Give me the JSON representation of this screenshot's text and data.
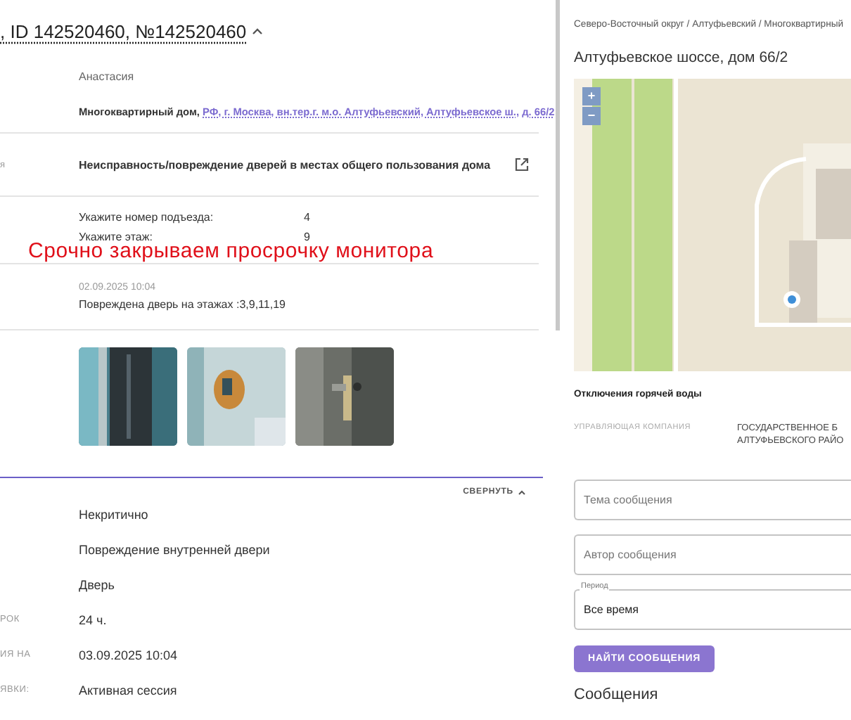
{
  "header": {
    "title": ", ID 142520460, №142520460",
    "expanded": true
  },
  "applicant": "Анастасия",
  "object": {
    "type": "Многоквартирный дом,",
    "address": "РФ, г. Москва, вн.тер.г. м.о. Алтуфьевский, Алтуфьевское ш., д. 66/2"
  },
  "problem": {
    "label": "я",
    "text": "Неисправность/повреждение дверей в местах общего пользования дома"
  },
  "questions": [
    {
      "question": "Укажите номер подъезда:",
      "answer": "4"
    },
    {
      "question": "Укажите этаж:",
      "answer": "9"
    }
  ],
  "overlay_note": "Срочно закрываем просрочку монитора",
  "comment": {
    "date": "02.09.2025 10:04",
    "text": "Повреждена дверь на этажах :3,9,11,19"
  },
  "details": {
    "collapse_button": "СВЕРНУТЬ",
    "expanded": true,
    "rows": [
      {
        "value": "Некритично"
      },
      {
        "value": "Повреждение внутренней двери"
      },
      {
        "value": "Дверь"
      },
      {
        "label": "РОК",
        "value": "24 ч."
      },
      {
        "label": "ИЯ НА",
        "value": "03.09.2025 10:04"
      },
      {
        "label": "ЯВКИ:",
        "value": "Активная сессия"
      }
    ]
  },
  "right": {
    "breadcrumb": "Северо-Восточный округ / Алтуфьевский / Многоквартирный",
    "title": "Алтуфьевское шоссе, дом 66/2",
    "map": {
      "kind": "picture",
      "zoom_in": "+",
      "zoom_out": "−"
    },
    "outage_title": "Отключения горячей воды",
    "company": {
      "label": "УПРАВЛЯЮЩАЯ КОМПАНИЯ",
      "value_lines": [
        "ГОСУДАРСТВЕННОЕ Б",
        "АЛТУФЬЕВСКОГО РАЙО"
      ]
    },
    "fields": [
      {
        "placeholder": "Тема сообщения"
      },
      {
        "placeholder": "Автор сообщения"
      },
      {
        "label": "Период",
        "value": "Все время"
      }
    ],
    "search_button": "НАЙТИ СООБЩЕНИЯ",
    "messages_heading": "Сообщения"
  }
}
